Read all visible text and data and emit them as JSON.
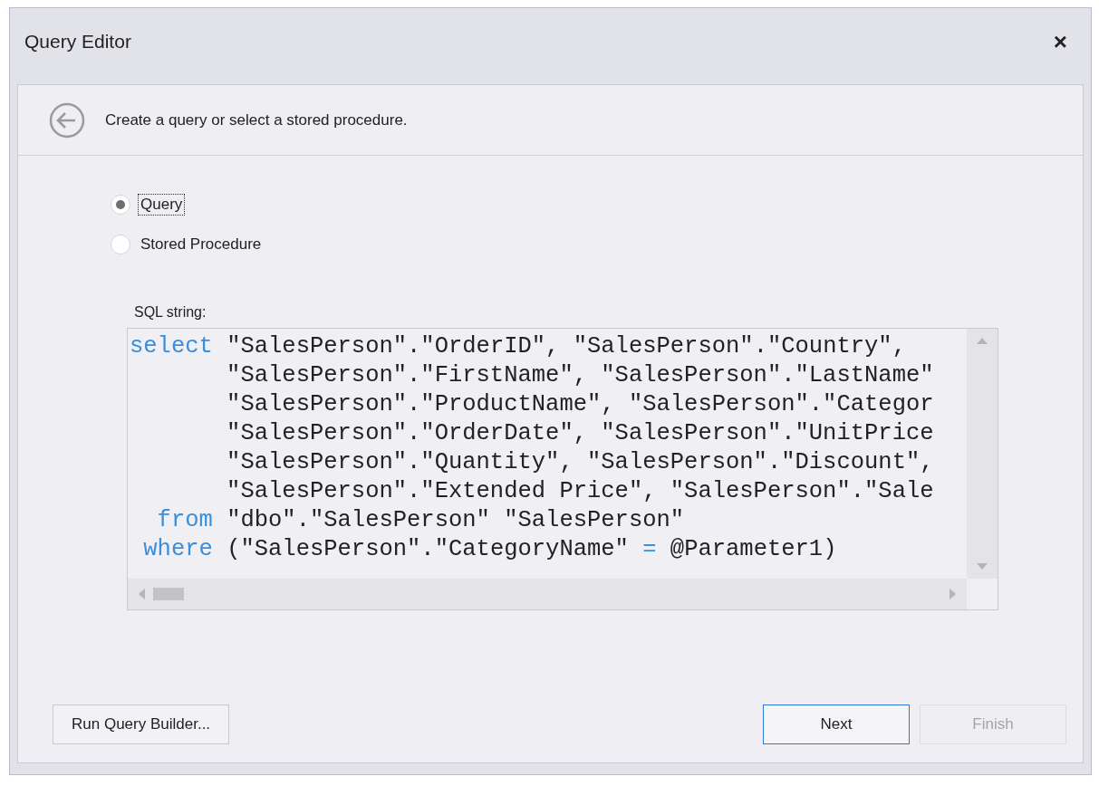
{
  "window": {
    "title": "Query Editor",
    "close": "×"
  },
  "header": {
    "text": "Create a query or select a stored procedure."
  },
  "options": [
    {
      "label": "Query",
      "selected": true
    },
    {
      "label": "Stored Procedure",
      "selected": false
    }
  ],
  "sql": {
    "label": "SQL string:",
    "lines": [
      [
        {
          "kind": "keyword",
          "text": "select"
        },
        {
          "kind": "plain",
          "text": " \"SalesPerson\".\"OrderID\", \"SalesPerson\".\"Country\","
        }
      ],
      [
        {
          "kind": "plain",
          "text": "       \"SalesPerson\".\"FirstName\", \"SalesPerson\".\"LastName\""
        }
      ],
      [
        {
          "kind": "plain",
          "text": "       \"SalesPerson\".\"ProductName\", \"SalesPerson\".\"Categor"
        }
      ],
      [
        {
          "kind": "plain",
          "text": "       \"SalesPerson\".\"OrderDate\", \"SalesPerson\".\"UnitPrice"
        }
      ],
      [
        {
          "kind": "plain",
          "text": "       \"SalesPerson\".\"Quantity\", \"SalesPerson\".\"Discount\","
        }
      ],
      [
        {
          "kind": "plain",
          "text": "       \"SalesPerson\".\"Extended Price\", \"SalesPerson\".\"Sale"
        }
      ],
      [
        {
          "kind": "keyword",
          "text": "  from"
        },
        {
          "kind": "plain",
          "text": " \"dbo\".\"SalesPerson\" \"SalesPerson\""
        }
      ],
      [
        {
          "kind": "keyword",
          "text": " where"
        },
        {
          "kind": "plain",
          "text": " (\"SalesPerson\".\"CategoryName\" "
        },
        {
          "kind": "keyword",
          "text": "="
        },
        {
          "kind": "plain",
          "text": " @Parameter1)"
        }
      ]
    ]
  },
  "buttons": [
    {
      "label": "Run Query Builder...",
      "kind": "left",
      "disabled": false,
      "focused": false
    },
    {
      "label": "Next",
      "kind": "right",
      "disabled": false,
      "focused": true
    },
    {
      "label": "Finish",
      "kind": "right",
      "disabled": true,
      "focused": false
    }
  ]
}
